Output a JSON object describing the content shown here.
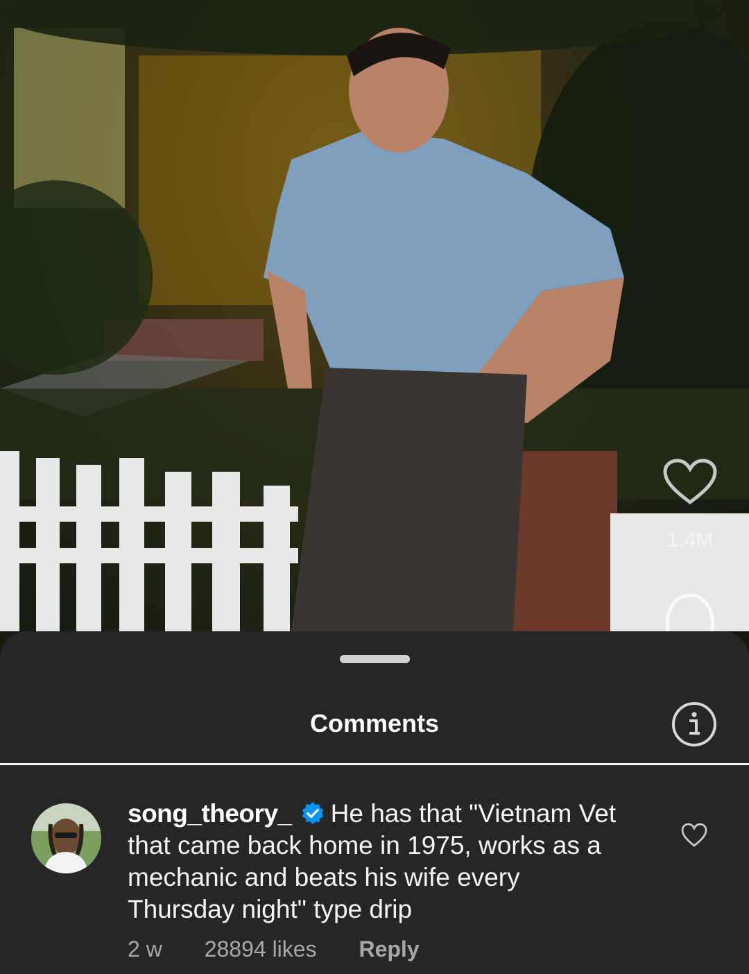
{
  "post": {
    "like_count": "1.4M",
    "icons": {
      "like": "heart-outline-icon",
      "comment": "comment-bubble-icon"
    }
  },
  "comments_sheet": {
    "title": "Comments",
    "info_icon": "info-icon",
    "comments": [
      {
        "username": "song_theory_",
        "verified": true,
        "text": "He has that \"Vietnam Vet that came back home in 1975, works as a mechanic and beats his wife every Thursday night\" type drip",
        "age": "2 w",
        "likes": "28894 likes",
        "reply_label": "Reply"
      }
    ]
  },
  "colors": {
    "sheet_background": "#262626",
    "verified_badge": "#0095f6",
    "meta_text": "#a8a8a8"
  }
}
